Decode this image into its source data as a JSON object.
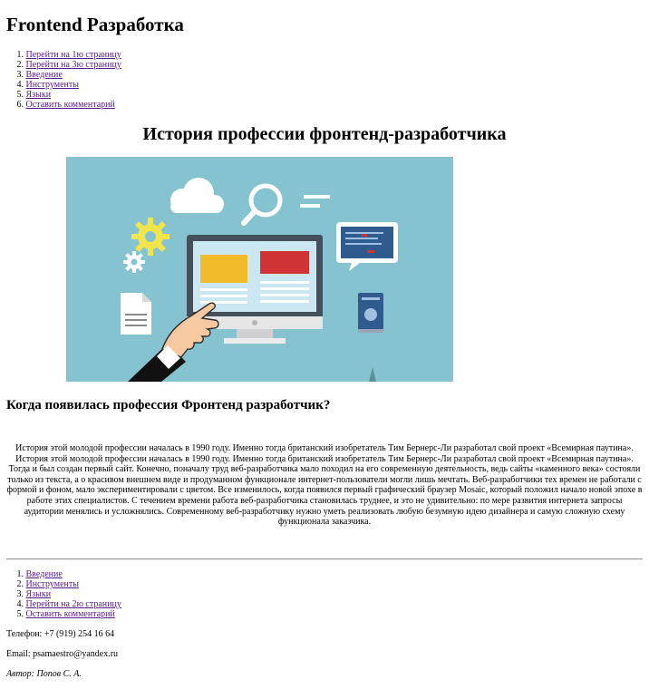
{
  "site_title": "Frontend Разработка",
  "top_nav": [
    {
      "num": "1.",
      "label": "Перейти на 1ю страницу"
    },
    {
      "num": "2.",
      "label": "Перейти на 3ю страницу"
    },
    {
      "num": "3.",
      "label": "Введение"
    },
    {
      "num": "4.",
      "label": "Инструменты"
    },
    {
      "num": "5.",
      "label": "Языки"
    },
    {
      "num": "6.",
      "label": "Оставить комментарий"
    }
  ],
  "article": {
    "title": "История профессии фронтенд-разработчика",
    "subtitle": "Когда появилась профессия Фронтенд разработчик?",
    "body": "История этой молодой профессии началась в 1990 году. Именно тогда британский изобретатель Тим Бернерс-Ли разработал свой проект «Всемирная паутина». История этой молодой профессии началась в 1990 году. Именно тогда британский изобретатель Тим Бернерс-Ли разработал свой проект «Всемирная паутина». Тогда и был создан первый сайт. Конечно, поначалу труд веб-разработчика мало походил на его современную деятельность, ведь сайты «каменного века» состояли только из текста, а о красивом внешнем виде и продуманном функционале интернет-пользователи могли лишь мечтать. Веб-разработчики тех времен не работали с формой и фоном, мало экспериментировали с цветом. Все изменилось, когда появился первый графический браузер Mosaic, который положил начало новой эпохе в работе этих специалистов. С течением времени работа веб-разработчика становилась труднее, и это не удивительно: по мере развития интернета запросы аудитории менялись и усложнялись. Современному веб-разработчику нужно уметь реализовать любую безумную идею дизайнера и самую сложную схему функционала заказчика."
  },
  "footer_nav": [
    {
      "num": "1.",
      "label": "Введение"
    },
    {
      "num": "2.",
      "label": "Инструменты"
    },
    {
      "num": "3.",
      "label": "Языки"
    },
    {
      "num": "4.",
      "label": "Перейти на 2ю страницу"
    },
    {
      "num": "5.",
      "label": "Оставить комментарий"
    }
  ],
  "footer": {
    "phone": "Телефон: +7 (919) 254 16 64",
    "email": "Email: psamaestro@yandex.ru",
    "author": "Автор: Попов С. А."
  },
  "colors": {
    "hero_bg": "#84c3cf",
    "monitor_dark": "#46505d",
    "yellow_block": "#f2bb2c",
    "red_block": "#cf3335",
    "gear_yellow": "#f2e54b",
    "link": "#551a8b"
  },
  "icons": [
    "cloud-icon",
    "magnifier-icon",
    "gear-icon",
    "document-icon",
    "monitor-icon",
    "hand-pointer-icon",
    "chat-bubble-icon",
    "phone-icon"
  ]
}
